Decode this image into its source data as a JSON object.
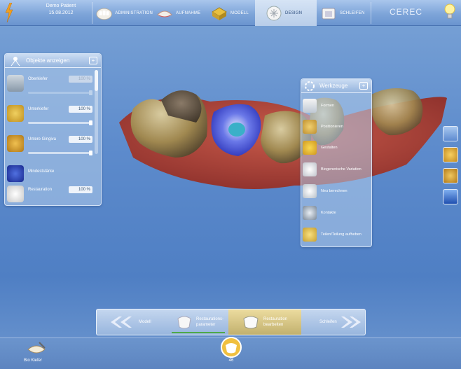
{
  "header": {
    "patient_name": "Demo Patient",
    "patient_date": "15.08.2012",
    "steps": [
      {
        "label": "ADMINISTRATION",
        "icon": "admin-teeth-icon"
      },
      {
        "label": "AUFNAHME",
        "icon": "scan-teeth-icon"
      },
      {
        "label": "MODELL",
        "icon": "model-icon"
      },
      {
        "label": "DESIGN",
        "icon": "design-teeth-icon",
        "active": true
      },
      {
        "label": "SCHLEIFEN",
        "icon": "milling-icon"
      }
    ],
    "brand": "CEREC"
  },
  "objects_panel": {
    "title": "Objekte anzeigen",
    "items": [
      {
        "label": "Oberkiefer",
        "value": "100 %",
        "disabled": true,
        "slider": 1.0
      },
      {
        "label": "Unterkiefer",
        "value": "100 %",
        "disabled": false,
        "slider": 1.0
      },
      {
        "label": "Untere Gingiva",
        "value": "100 %",
        "disabled": false,
        "slider": 1.0
      },
      {
        "label": "Mindeststärke",
        "value": "",
        "disabled": false
      },
      {
        "label": "Restauration",
        "value": "100 %",
        "disabled": false
      }
    ]
  },
  "tools_panel": {
    "title": "Werkzeuge",
    "items": [
      {
        "label": "Formen"
      },
      {
        "label": "Positionieren"
      },
      {
        "label": "Gestalten"
      },
      {
        "label": "Biogenerische Variation"
      },
      {
        "label": "Neu berechnen"
      },
      {
        "label": "Kontakte"
      },
      {
        "label": "Teilen/Teilung aufheben"
      }
    ]
  },
  "bottom_nav": {
    "back_label": "Modell",
    "step1_line1": "Restaurations-",
    "step1_line2": "parameter",
    "step2_line1": "Restauration",
    "step2_line2": "bearbeiten",
    "next_label": "Schleifen"
  },
  "footer": {
    "bio_label": "Bio Kiefer",
    "tooth_number": "46"
  },
  "colors": {
    "accent_gold": "#e0b54a",
    "progress_green": "#4ea94a",
    "panel_blue": "#b4cdeb"
  }
}
